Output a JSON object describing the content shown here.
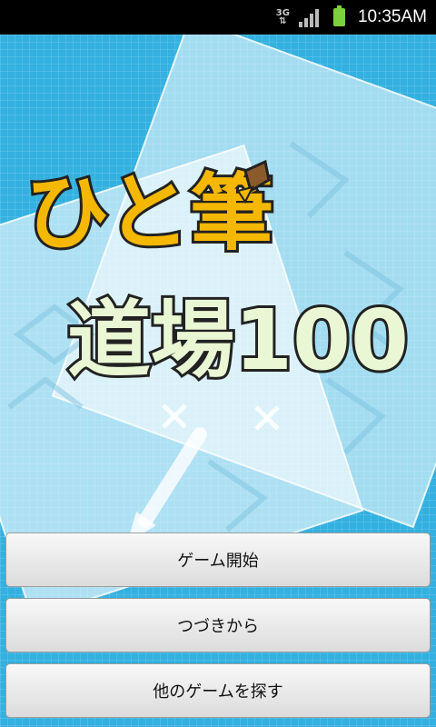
{
  "status_bar": {
    "network": "3G",
    "time": "10:35AM"
  },
  "title": {
    "line1": "ひと筆",
    "line2": "道場100"
  },
  "buttons": [
    {
      "label": "ゲーム開始"
    },
    {
      "label": "つづきから"
    },
    {
      "label": "他のゲームを探す"
    }
  ]
}
